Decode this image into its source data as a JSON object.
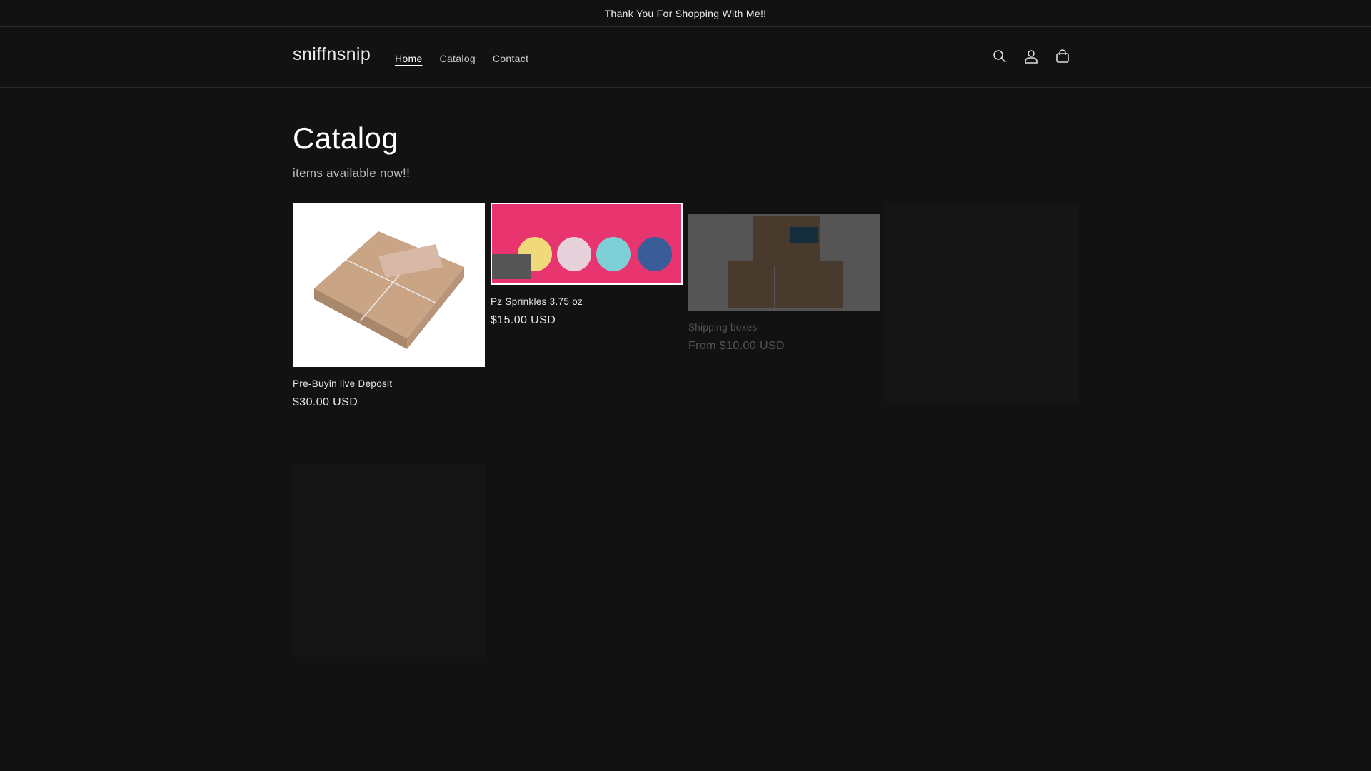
{
  "announcement": "Thank You For Shopping With Me!!",
  "header": {
    "logo": "sniffnsnip",
    "nav": [
      {
        "label": "Home",
        "active": true
      },
      {
        "label": "Catalog"
      },
      {
        "label": "Contact"
      }
    ],
    "icons": [
      "search-icon",
      "account-icon",
      "cart-icon"
    ]
  },
  "page": {
    "title": "Catalog",
    "subtitle": "items available now!!"
  },
  "products": [
    {
      "title": "Pre-Buyin live Deposit",
      "price": "$30.00 USD"
    },
    {
      "title": "Pz Sprinkles 3.75 oz",
      "price": "$15.00 USD"
    },
    {
      "title": "Shipping boxes",
      "price": "From $10.00 USD"
    }
  ],
  "colors": {
    "background": "#121212",
    "text": "#ffffff",
    "sprinkles_bg": "#e8356f"
  }
}
